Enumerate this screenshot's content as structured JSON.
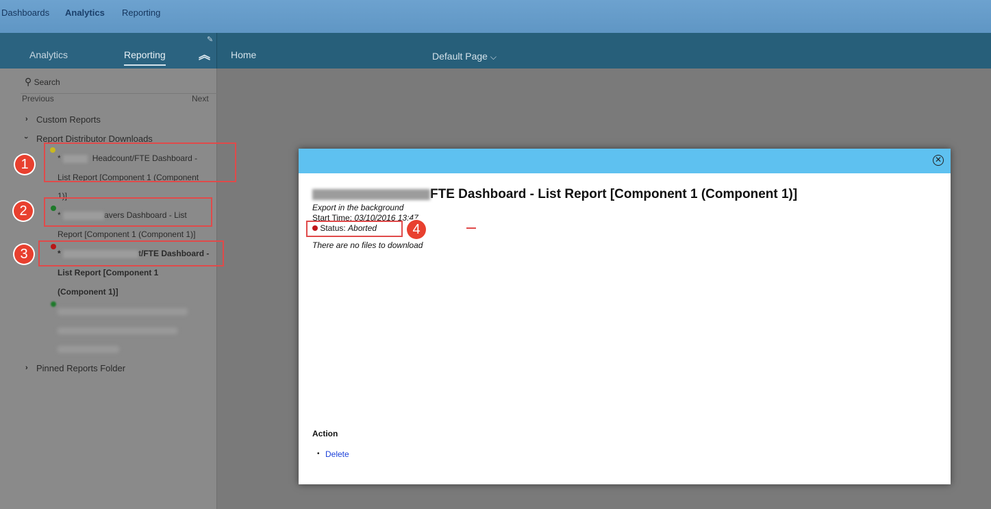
{
  "top_nav": {
    "dashboards": "Dashboards",
    "analytics": "Analytics",
    "reporting": "Reporting"
  },
  "panel": {
    "tab_analytics": "Analytics",
    "tab_reporting": "Reporting",
    "pin_icon": "pin-icon",
    "collapse_icon": "double-chevron-up-icon",
    "home": "Home",
    "default_page": "Default Page",
    "chevron": "⌵"
  },
  "sidebar": {
    "search": "Search",
    "previous": "Previous",
    "next": "Next",
    "custom_reports": "Custom Reports",
    "report_distributor": "Report Distributor Downloads",
    "pinned": "Pinned Reports Folder",
    "item1": {
      "line1": "Headcount/FTE Dashboard -",
      "line2": "List Report [Component 1 (Component",
      "line3": "1)]",
      "status_color": "#c8b820"
    },
    "item2": {
      "line1": "avers Dashboard - List",
      "line2": "Report [Component 1 (Component 1)]",
      "status_color": "#1d7a2a"
    },
    "item3": {
      "line1": "t/FTE Dashboard -",
      "line2": "List Report [Component 1",
      "line3": "(Component 1)]",
      "status_color": "#b81818"
    },
    "item4_status_color": "#1d7a2a"
  },
  "annotations": {
    "b1": "1",
    "b2": "2",
    "b3": "3",
    "b4": "4",
    "color": "#e8402f"
  },
  "modal": {
    "title_suffix": "FTE Dashboard - List Report [Component 1 (Component 1)]",
    "export_note": "Export in the background",
    "start_time_label": "Start Time:",
    "start_time_value": "03/10/2016 13:47",
    "status_label": "Status:",
    "status_value": "Aborted",
    "status_color": "#c0161a",
    "no_files": "There are no files to download",
    "action_heading": "Action",
    "delete": "Delete",
    "close_icon": "close-circle-icon"
  }
}
